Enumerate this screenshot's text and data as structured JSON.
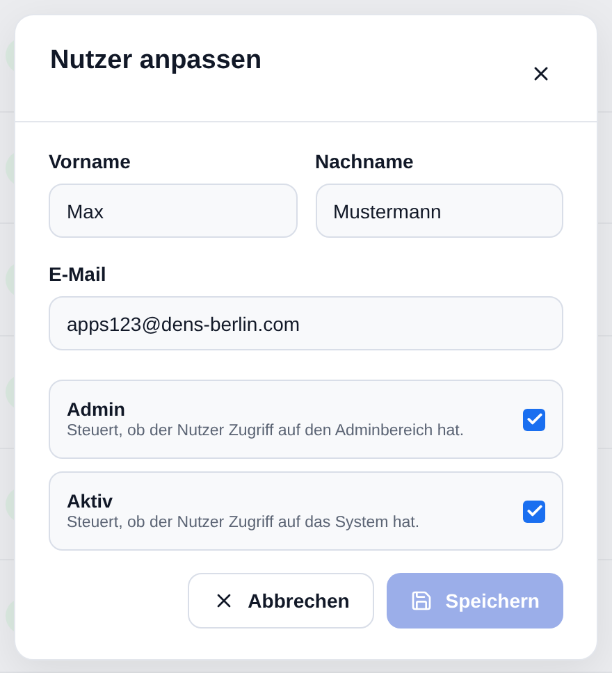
{
  "dialog": {
    "title": "Nutzer anpassen"
  },
  "fields": [
    {
      "label": "Vorname",
      "value": "Max"
    },
    {
      "label": "Nachname",
      "value": "Mustermann"
    },
    {
      "label": "E-Mail",
      "value": "apps123@dens-berlin.com"
    }
  ],
  "options": [
    {
      "title": "Admin",
      "description": "Steuert, ob der Nutzer Zugriff auf den Adminbereich hat.",
      "checked": true
    },
    {
      "title": "Aktiv",
      "description": "Steuert, ob der Nutzer Zugriff auf das System hat.",
      "checked": true
    }
  ],
  "buttons": [
    {
      "kind": "cancel",
      "label": "Abbrechen",
      "disabled": false
    },
    {
      "kind": "save",
      "label": "Speichern",
      "disabled": true
    }
  ]
}
